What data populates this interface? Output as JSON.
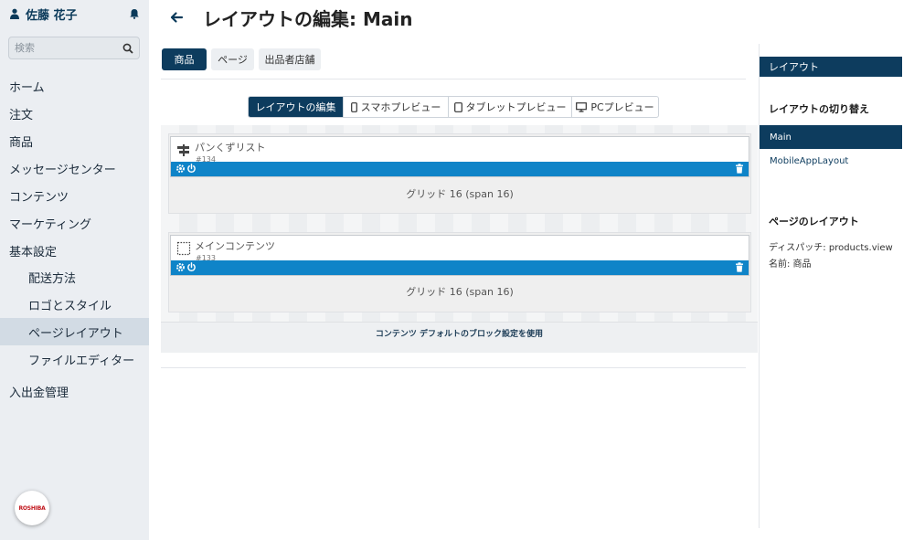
{
  "user": {
    "name": "佐藤 花子"
  },
  "search": {
    "placeholder": "検索"
  },
  "sidebar": {
    "items": [
      {
        "label": "ホーム"
      },
      {
        "label": "注文"
      },
      {
        "label": "商品"
      },
      {
        "label": "メッセージセンター"
      },
      {
        "label": "コンテンツ"
      },
      {
        "label": "マーケティング"
      },
      {
        "label": "基本設定"
      },
      {
        "label": "配送方法"
      },
      {
        "label": "ロゴとスタイル"
      },
      {
        "label": "ページレイアウト",
        "active": true
      },
      {
        "label": "ファイルエディター"
      },
      {
        "label": "入出金管理"
      }
    ],
    "logo_text": "ROSHIBA"
  },
  "header": {
    "title": "レイアウトの編集: Main"
  },
  "tabs": [
    {
      "label": "商品",
      "active": true
    },
    {
      "label": "ページ"
    },
    {
      "label": "出品者店舗"
    }
  ],
  "modes": [
    {
      "label": "レイアウトの編集",
      "active": true
    },
    {
      "label": "スマホプレビュー"
    },
    {
      "label": "タブレットプレビュー"
    },
    {
      "label": "PCプレビュー"
    }
  ],
  "blocks": [
    {
      "title": "パンくずリスト",
      "id": "#134",
      "grid_label": "グリッド 16 (span 16)"
    },
    {
      "title": "メインコンテンツ",
      "id": "#133",
      "grid_label": "グリッド 16 (span 16)"
    }
  ],
  "content_note": "コンテンツ デフォルトのブロック設定を使用",
  "right_panel": {
    "header": "レイアウト",
    "switch_title": "レイアウトの切り替え",
    "layouts": [
      {
        "label": "Main",
        "active": true
      },
      {
        "label": "MobileAppLayout"
      }
    ],
    "page_layout_title": "ページのレイアウト",
    "dispatch": "ディスパッチ: products.view",
    "name": "名前: 商品"
  },
  "colors": {
    "primary": "#0d3c5e",
    "block_bar": "#0f84c8",
    "sidebar_bg": "#ebeef2"
  }
}
